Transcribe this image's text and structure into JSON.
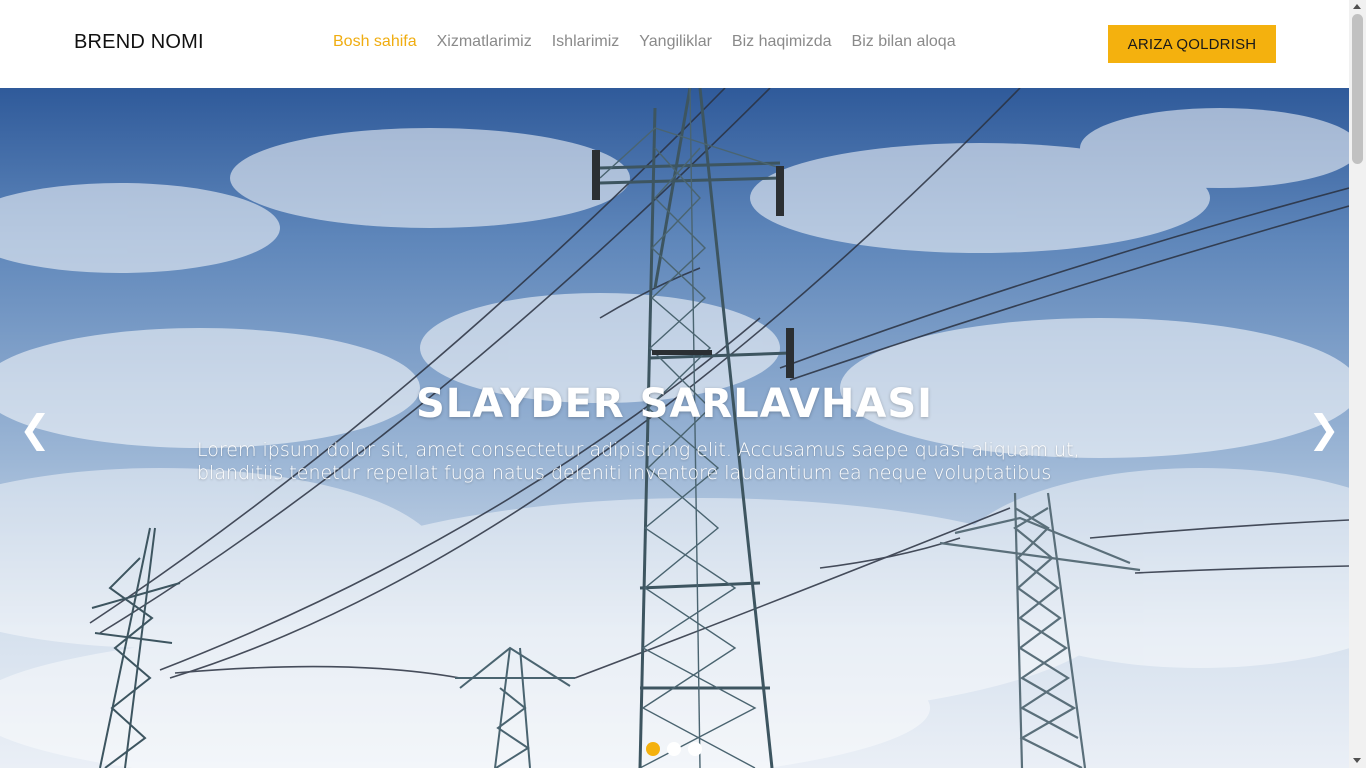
{
  "header": {
    "brand": "BREND NOMI",
    "nav": [
      {
        "label": "Bosh sahifa",
        "active": true
      },
      {
        "label": "Xizmatlarimiz",
        "active": false
      },
      {
        "label": "Ishlarimiz",
        "active": false
      },
      {
        "label": "Yangiliklar",
        "active": false
      },
      {
        "label": "Biz haqimizda",
        "active": false
      },
      {
        "label": "Biz bilan aloqa",
        "active": false
      }
    ],
    "cta_label": "ARIZA QOLDRISH"
  },
  "slider": {
    "title": "SLAYDER SARLAVHASI",
    "text": "Lorem ipsum dolor sit, amet consectetur adipisicing elit. Accusamus saepe quasi aliquam ut, blanditiis tenetur repellat fuga natus deleniti inventore laudantium ea neque voluptatibus",
    "prev_icon": "chevron-left-icon",
    "next_icon": "chevron-right-icon",
    "prev_glyph": "❮",
    "next_glyph": "❯",
    "slide_count": 3,
    "active_slide": 1
  },
  "colors": {
    "accent": "#f4b10e",
    "nav_active": "#f0ad11",
    "nav_inactive": "#8a8a8a"
  }
}
